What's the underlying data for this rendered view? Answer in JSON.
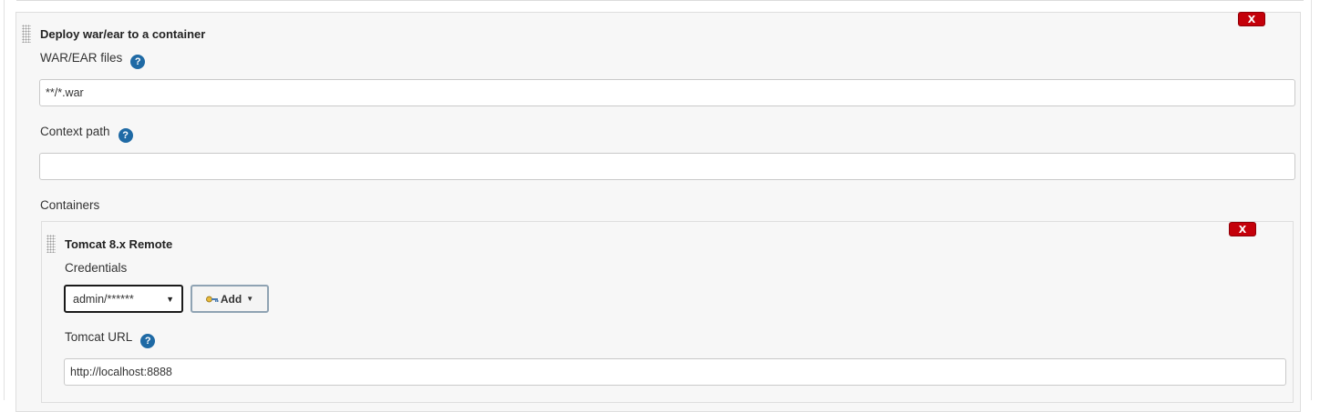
{
  "deploy_section": {
    "title": "Deploy war/ear to a container",
    "delete_label": "X",
    "war_files": {
      "label": "WAR/EAR files",
      "help": "?",
      "value": "**/*.war"
    },
    "context_path": {
      "label": "Context path",
      "help": "?",
      "value": ""
    },
    "containers_label": "Containers"
  },
  "container": {
    "title": "Tomcat 8.x Remote",
    "delete_label": "X",
    "credentials": {
      "label": "Credentials",
      "selected": "admin/******",
      "add_label": "Add"
    },
    "tomcat_url": {
      "label": "Tomcat URL",
      "help": "?",
      "value": "http://localhost:8888"
    }
  },
  "colors": {
    "delete_red": "#c4000a",
    "help_blue": "#1f6aa5",
    "panel_bg": "#f7f7f7"
  },
  "icons": [
    "drag-handle-icon",
    "help-icon",
    "key-icon",
    "caret-down-icon"
  ]
}
